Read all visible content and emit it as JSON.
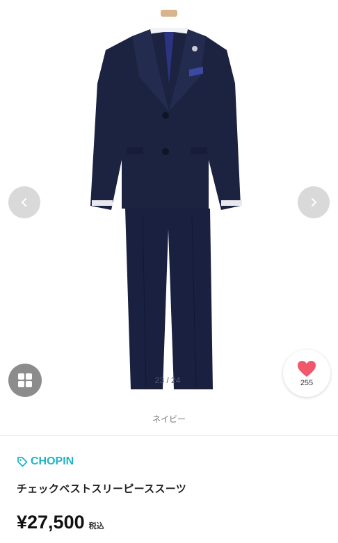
{
  "gallery": {
    "image_alt": "チェックベストスリーピーススーツ",
    "image_index": "23 / 24",
    "prev_icon": "chevron-left-icon",
    "next_icon": "chevron-right-icon",
    "grid_icon": "grid-icon"
  },
  "favorite": {
    "icon": "heart-icon",
    "count": "255",
    "color": "#f0566c"
  },
  "color_name": "ネイビー",
  "brand": {
    "icon": "tag-icon",
    "name": "CHOPIN",
    "color": "#1eb4c8"
  },
  "product": {
    "name": "チェックベストスリーピーススーツ",
    "price": "¥27,500",
    "tax_label": "税込"
  }
}
